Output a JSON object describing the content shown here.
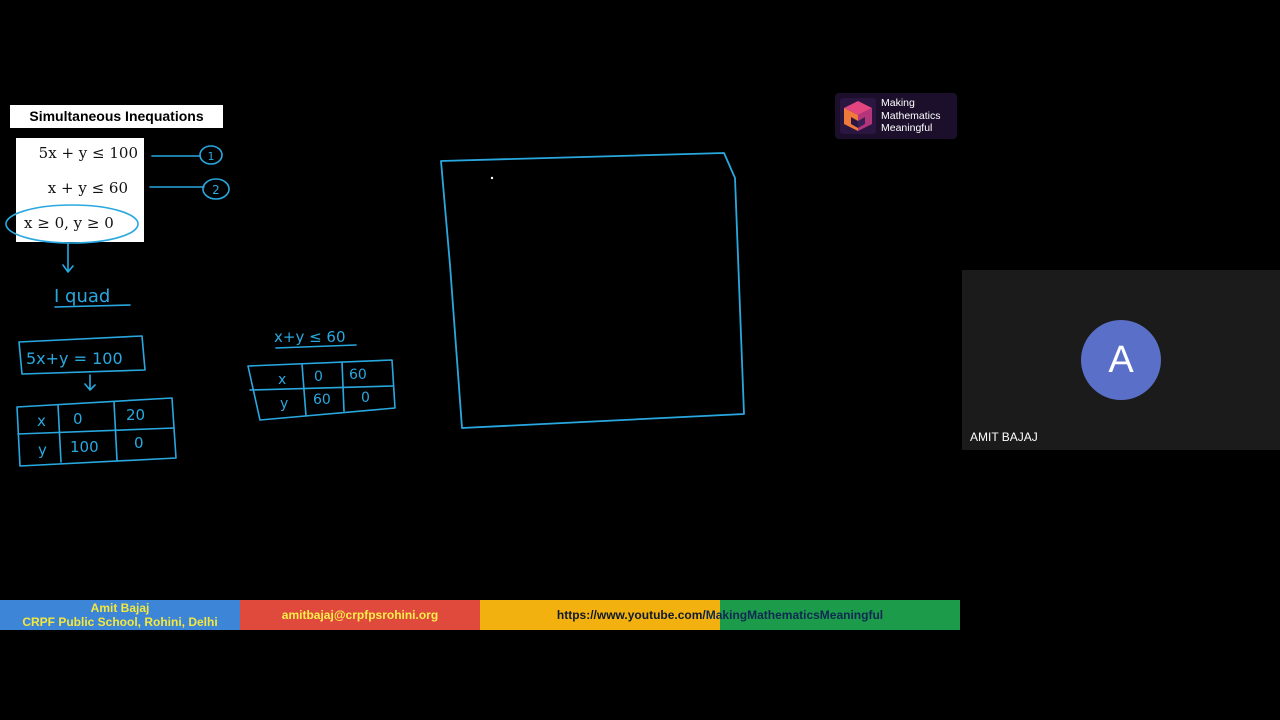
{
  "slide": {
    "title": "Simultaneous Inequations",
    "equations": [
      "5x + y ≤ 100",
      "x + y ≤ 60",
      "x ≥ 0,  y ≥ 0"
    ]
  },
  "handwriting": {
    "label_1": "1",
    "label_2": "2",
    "quadrant_note": "I quad",
    "eq1": "5x+y = 100",
    "eq2": "x+y ≤ 60",
    "table1": {
      "x_label": "x",
      "y_label": "y",
      "x_values": [
        "0",
        "20"
      ],
      "y_values": [
        "100",
        "0"
      ]
    },
    "table2": {
      "x_label": "x",
      "y_label": "y",
      "x_values": [
        "0",
        "60"
      ],
      "y_values": [
        "60",
        "0"
      ]
    }
  },
  "logo": {
    "line1": "Making",
    "line2": "Mathematics",
    "line3": "Meaningful"
  },
  "footer": {
    "name": "Amit Bajaj",
    "school": "CRPF Public School, Rohini, Delhi",
    "email": "amitbajaj@crpfpsrohini.org",
    "url_part1": "https://www.youtube.com/",
    "url_part2": "MakingMathematicsMeaningful"
  },
  "participant": {
    "initial": "A",
    "name": "AMIT BAJAJ",
    "avatar_color": "#5a70c8"
  },
  "colors": {
    "ink": "#29a8e0",
    "footer_blue": "#3d85d6",
    "footer_red": "#e04a3c",
    "footer_yellow": "#f2b10f",
    "footer_green": "#1c9b4b"
  }
}
